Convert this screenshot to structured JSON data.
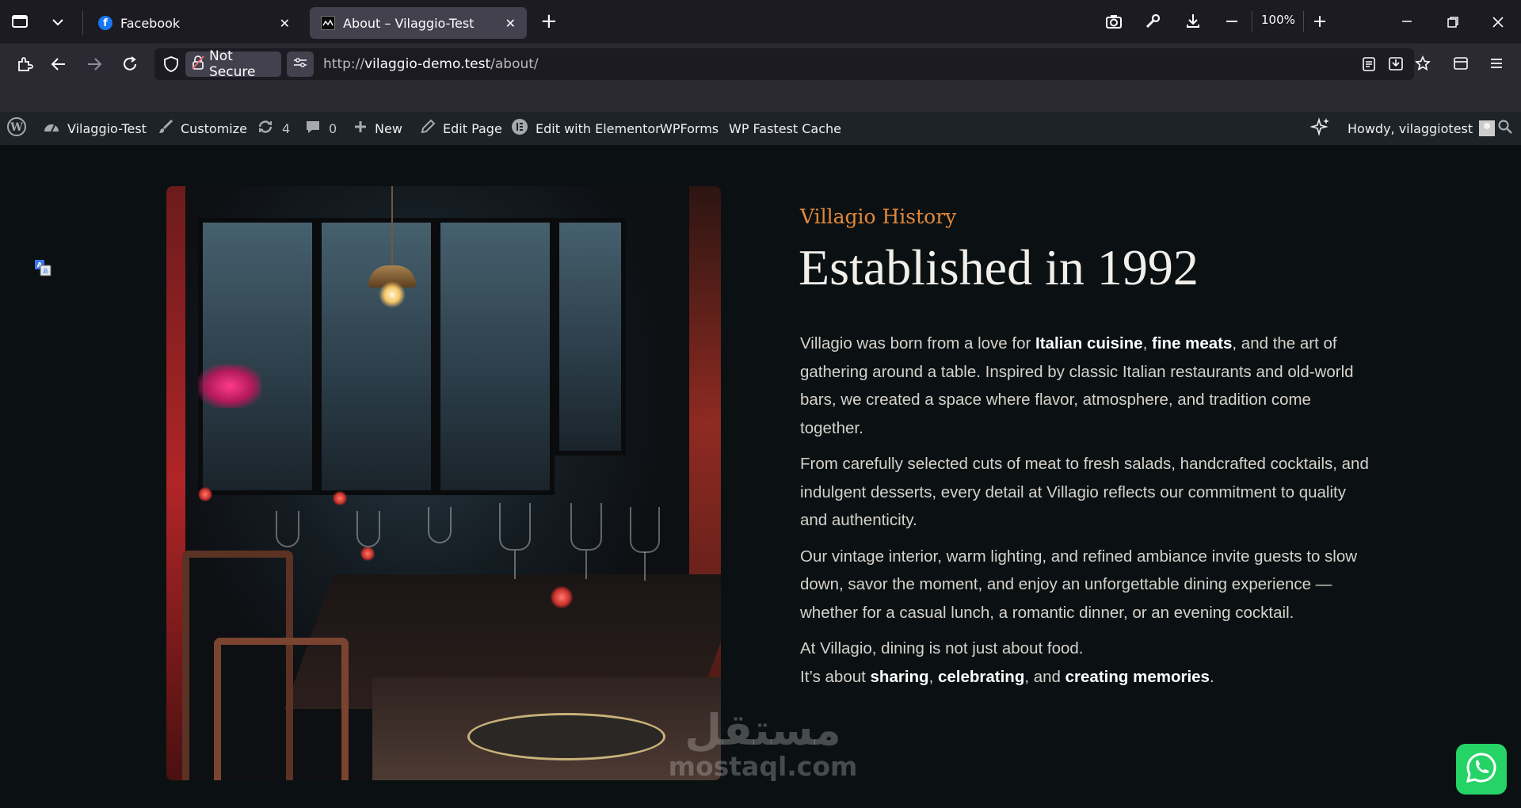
{
  "browser": {
    "tabs": [
      {
        "title": "Facebook",
        "favicon": "facebook-icon",
        "active": false
      },
      {
        "title": "About – Vilaggio-Test",
        "favicon": "site-icon",
        "active": true
      }
    ],
    "new_tab": "+",
    "zoom": "100%",
    "security_label": "Not Secure",
    "url_scheme": "http://",
    "url_host": "vilaggio-demo.test",
    "url_path": "/about/"
  },
  "admin_bar": {
    "site_name": "Vilaggio-Test",
    "customize": "Customize",
    "updates_count": "4",
    "comments_count": "0",
    "new": "New",
    "edit_page": "Edit Page",
    "edit_elementor": "Edit with Elementor",
    "wpforms": "WPForms",
    "fastest_cache": "WP Fastest Cache",
    "howdy": "Howdy, vilaggiotest"
  },
  "page": {
    "subtitle": "Villagio History",
    "heading": "Established in 1992",
    "p1": {
      "t1": "Villagio was born from a love for ",
      "b1": "Italian cuisine",
      "t2": ", ",
      "b2": "fine meats",
      "t3": ", and the art of gathering around a table. Inspired by classic Italian restaurants and old-world bars, we created a space where flavor, atmosphere, and tradition come together."
    },
    "p2": "From carefully selected cuts of meat to fresh salads, handcrafted cocktails, and indulgent desserts, every detail at Villagio reflects our commitment to quality and authenticity.",
    "p3": "Our vintage interior, warm lighting, and refined ambiance invite guests to slow down, savor the moment, and enjoy an unforgettable dining experience — whether for a casual lunch, a romantic dinner, or an evening cocktail.",
    "p4": {
      "line1": "At Villagio, dining is not just about food.",
      "t1": "It’s about ",
      "b1": "sharing",
      "t2": ", ",
      "b2": "celebrating",
      "t3": ", and ",
      "b3": "creating memories",
      "t4": "."
    }
  },
  "watermark": {
    "arabic": "مستقل",
    "latin": "mostaql.com"
  },
  "colors": {
    "accent": "#e2873a",
    "background": "#0b1112",
    "whatsapp": "#25d366"
  }
}
